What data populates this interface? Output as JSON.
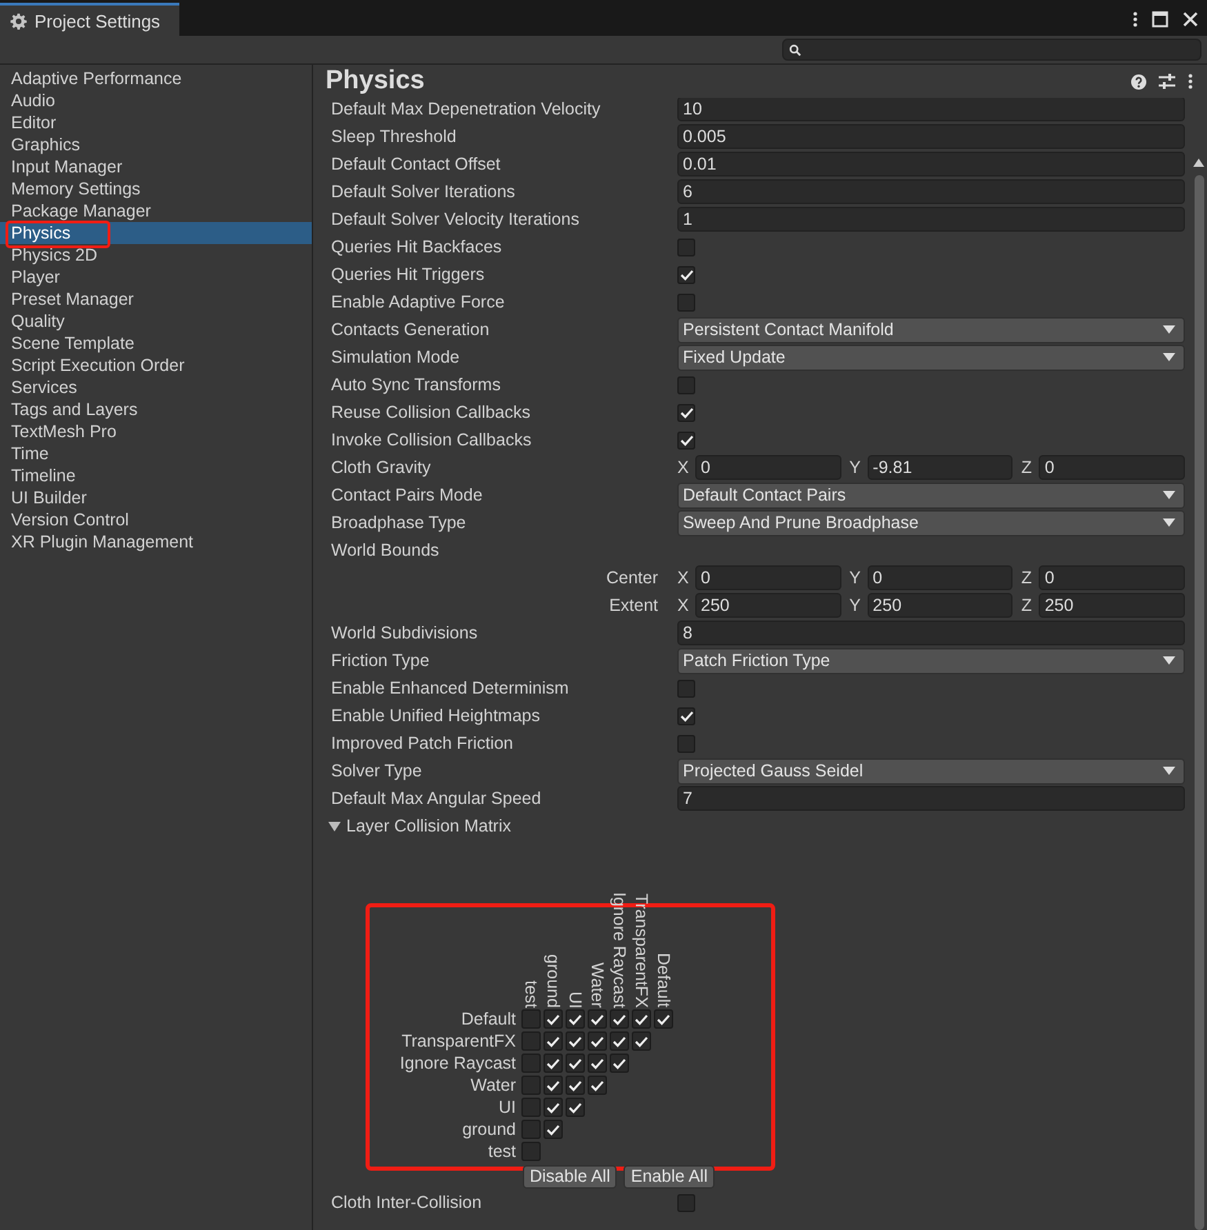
{
  "window": {
    "tab": "Project Settings"
  },
  "sidebar": {
    "items": [
      {
        "label": "Adaptive Performance",
        "selected": false
      },
      {
        "label": "Audio",
        "selected": false
      },
      {
        "label": "Editor",
        "selected": false
      },
      {
        "label": "Graphics",
        "selected": false
      },
      {
        "label": "Input Manager",
        "selected": false
      },
      {
        "label": "Memory Settings",
        "selected": false
      },
      {
        "label": "Package Manager",
        "selected": false
      },
      {
        "label": "Physics",
        "selected": true
      },
      {
        "label": "Physics 2D",
        "selected": false
      },
      {
        "label": "Player",
        "selected": false
      },
      {
        "label": "Preset Manager",
        "selected": false
      },
      {
        "label": "Quality",
        "selected": false
      },
      {
        "label": "Scene Template",
        "selected": false
      },
      {
        "label": "Script Execution Order",
        "selected": false
      },
      {
        "label": "Services",
        "selected": false
      },
      {
        "label": "Tags and Layers",
        "selected": false
      },
      {
        "label": "TextMesh Pro",
        "selected": false
      },
      {
        "label": "Time",
        "selected": false
      },
      {
        "label": "Timeline",
        "selected": false
      },
      {
        "label": "UI Builder",
        "selected": false
      },
      {
        "label": "Version Control",
        "selected": false
      },
      {
        "label": "XR Plugin Management",
        "selected": false
      }
    ]
  },
  "page": {
    "title": "Physics"
  },
  "settings": [
    {
      "kind": "text",
      "label": "Default Max Depenetration Velocity",
      "value": "10"
    },
    {
      "kind": "text",
      "label": "Sleep Threshold",
      "value": "0.005"
    },
    {
      "kind": "text",
      "label": "Default Contact Offset",
      "value": "0.01"
    },
    {
      "kind": "text",
      "label": "Default Solver Iterations",
      "value": "6"
    },
    {
      "kind": "text",
      "label": "Default Solver Velocity Iterations",
      "value": "1"
    },
    {
      "kind": "checkbox",
      "label": "Queries Hit Backfaces",
      "checked": false
    },
    {
      "kind": "checkbox",
      "label": "Queries Hit Triggers",
      "checked": true
    },
    {
      "kind": "checkbox",
      "label": "Enable Adaptive Force",
      "checked": false
    },
    {
      "kind": "dropdown",
      "label": "Contacts Generation",
      "value": "Persistent Contact Manifold"
    },
    {
      "kind": "dropdown",
      "label": "Simulation Mode",
      "value": "Fixed Update"
    },
    {
      "kind": "checkbox",
      "label": "Auto Sync Transforms",
      "checked": false
    },
    {
      "kind": "checkbox",
      "label": "Reuse Collision Callbacks",
      "checked": true
    },
    {
      "kind": "checkbox",
      "label": "Invoke Collision Callbacks",
      "checked": true
    },
    {
      "kind": "vector",
      "label": "Cloth Gravity",
      "parts": [
        {
          "axis": "X",
          "value": "0"
        },
        {
          "axis": "Y",
          "value": "-9.81"
        },
        {
          "axis": "Z",
          "value": "0"
        }
      ]
    },
    {
      "kind": "dropdown",
      "label": "Contact Pairs Mode",
      "value": "Default Contact Pairs"
    },
    {
      "kind": "dropdown",
      "label": "Broadphase Type",
      "value": "Sweep And Prune Broadphase"
    },
    {
      "kind": "heading",
      "label": "World Bounds"
    },
    {
      "kind": "subvector",
      "label": "Center",
      "parts": [
        {
          "axis": "X",
          "value": "0"
        },
        {
          "axis": "Y",
          "value": "0"
        },
        {
          "axis": "Z",
          "value": "0"
        }
      ]
    },
    {
      "kind": "subvector",
      "label": "Extent",
      "parts": [
        {
          "axis": "X",
          "value": "250"
        },
        {
          "axis": "Y",
          "value": "250"
        },
        {
          "axis": "Z",
          "value": "250"
        }
      ]
    },
    {
      "kind": "text",
      "label": "World Subdivisions",
      "value": "8"
    },
    {
      "kind": "dropdown",
      "label": "Friction Type",
      "value": "Patch Friction Type"
    },
    {
      "kind": "checkbox",
      "label": "Enable Enhanced Determinism",
      "checked": false
    },
    {
      "kind": "checkbox",
      "label": "Enable Unified Heightmaps",
      "checked": true
    },
    {
      "kind": "checkbox",
      "label": "Improved Patch Friction",
      "checked": false
    },
    {
      "kind": "dropdown",
      "label": "Solver Type",
      "value": "Projected Gauss Seidel"
    },
    {
      "kind": "text",
      "label": "Default Max Angular Speed",
      "value": "7"
    }
  ],
  "matrix": {
    "title": "Layer Collision Matrix",
    "expanded": true,
    "columns": [
      "test",
      "ground",
      "UI",
      "Water",
      "Ignore Raycast",
      "TransparentFX",
      "Default"
    ],
    "rows": [
      {
        "label": "Default",
        "cells": [
          false,
          true,
          true,
          true,
          true,
          true,
          true
        ]
      },
      {
        "label": "TransparentFX",
        "cells": [
          false,
          true,
          true,
          true,
          true,
          true
        ]
      },
      {
        "label": "Ignore Raycast",
        "cells": [
          false,
          true,
          true,
          true,
          true
        ]
      },
      {
        "label": "Water",
        "cells": [
          false,
          true,
          true,
          true
        ]
      },
      {
        "label": "UI",
        "cells": [
          false,
          true,
          true
        ]
      },
      {
        "label": "ground",
        "cells": [
          false,
          true
        ]
      },
      {
        "label": "test",
        "cells": [
          false
        ]
      }
    ],
    "buttons": [
      "Disable All",
      "Enable All"
    ]
  },
  "after_matrix": [
    {
      "kind": "checkbox",
      "label": "Cloth Inter-Collision",
      "checked": false
    }
  ]
}
